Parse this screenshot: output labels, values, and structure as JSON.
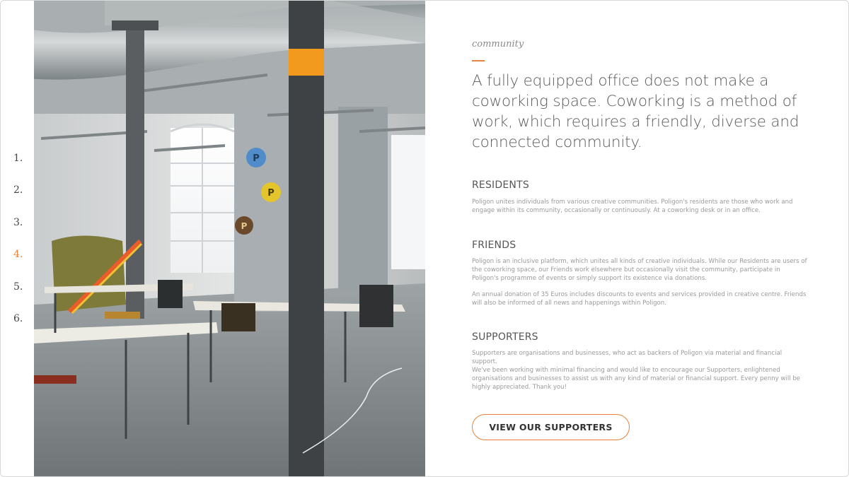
{
  "nav": {
    "items": [
      "1.",
      "2.",
      "3.",
      "4.",
      "5.",
      "6."
    ],
    "active_index": 3,
    "active_color": "#e8823c"
  },
  "photo": {
    "logo_mark": "P",
    "description_icons": [
      "poligon-logo-blue",
      "poligon-logo-yellow",
      "poligon-logo-brown"
    ]
  },
  "content": {
    "kicker": "community",
    "lead": "A fully equipped office does not make a coworking space. Coworking is a method of work, which requires  a friendly, diverse and connected community.",
    "sections": {
      "residents": {
        "title": "RESIDENTS",
        "paragraphs": [
          "Poligon unites individuals from various creative communities. Poligon's residents are those who work and engage within its community, occasionally or continuously. At a coworking desk or in an office."
        ]
      },
      "friends": {
        "title": "FRIENDS",
        "paragraphs": [
          "Poligon is an inclusive platform, which unites all kinds of creative individuals. While our Residents are users of the coworking space, our Friends work elsewhere but occasionally visit the community, participate in Poligon's programme of events or simply support its existence via donations.",
          "An annual donation of 35 Euros includes discounts to events and services provided in creative centre. Friends will also be informed of all news and happenings within Poligon."
        ]
      },
      "supporters": {
        "title": "SUPPORTERS",
        "paragraphs": [
          "Supporters are organisations and businesses, who act as backers of Poligon via material and financial support.",
          "We've been working with minimal financing and would like to encourage our Supporters, enlightened organisations and businesses to assist us with any kind of material or financial support. Every penny will be highly appreciated. Thank you!"
        ]
      }
    },
    "cta_label": "VIEW OUR SUPPORTERS",
    "accent_color": "#e8823c"
  }
}
